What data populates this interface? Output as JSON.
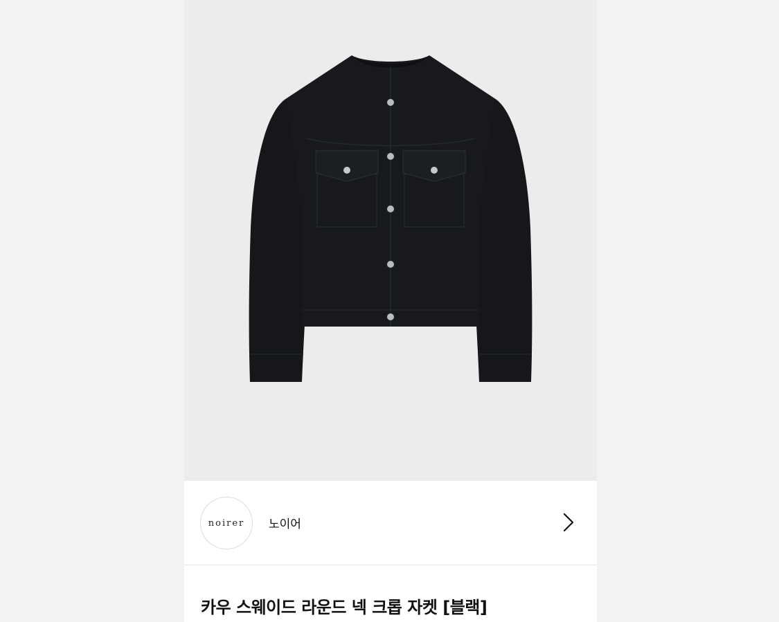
{
  "product": {
    "image_icon": "black-suede-crop-jacket-image",
    "title": "카우 스웨이드 라운드 넥 크롭 자켓 [블랙]"
  },
  "brand": {
    "logo_text": "noirer",
    "name": "노이어",
    "chevron_icon": "chevron-right-icon"
  },
  "colors": {
    "background": "#f2f2f4",
    "hero_bg": "#ececec",
    "jacket": "#16181c",
    "text": "#111111"
  }
}
